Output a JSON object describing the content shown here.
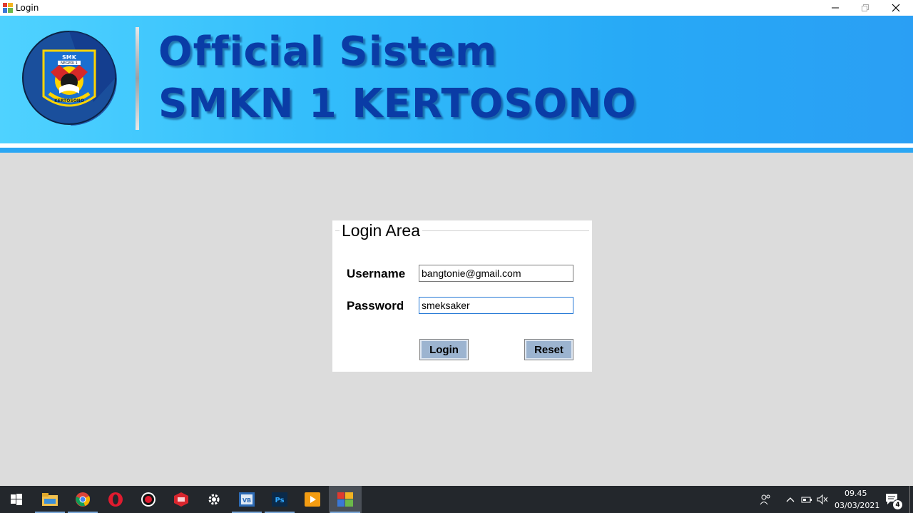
{
  "window": {
    "title": "Login",
    "controls": {
      "minimize": "—",
      "restore": "❐",
      "close": "✕"
    }
  },
  "banner": {
    "line1": "Official Sistem",
    "line2": "SMKN 1 KERTOSONO",
    "logo": {
      "top_text": "SMK",
      "ribbon_text": "NEGERI 1",
      "bottom_text": "KERTOSONO"
    },
    "colors": {
      "accent": "#2aa6f3",
      "title": "#0a3ca6"
    }
  },
  "login": {
    "group_title": "Login Area",
    "username_label": "Username",
    "password_label": "Password",
    "username_value": "bangtonie@gmail.com",
    "password_value": "smeksaker",
    "login_button": "Login",
    "reset_button": "Reset"
  },
  "taskbar": {
    "apps": [
      "start-icon",
      "file-explorer-icon",
      "chrome-icon",
      "opera-icon",
      "record-icon",
      "sketchup-icon",
      "settings-icon",
      "vb-icon",
      "photoshop-icon",
      "media-player-icon",
      "login-app-icon"
    ],
    "time": "09.45",
    "date": "03/03/2021",
    "notification_count": "4"
  }
}
